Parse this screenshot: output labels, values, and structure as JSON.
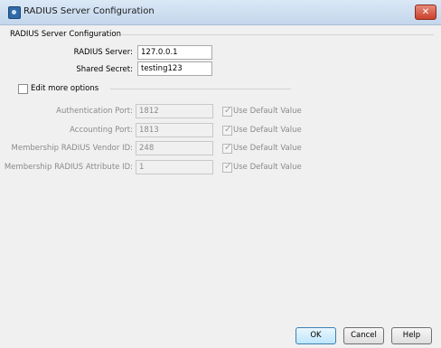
{
  "window": {
    "title": "RADIUS Server Configuration",
    "close_symbol": "✕"
  },
  "group": {
    "title": "RADIUS Server Configuration"
  },
  "server": {
    "label": "RADIUS Server:",
    "value": "127.0.0.1"
  },
  "secret": {
    "label": "Shared Secret:",
    "value": "testing123"
  },
  "edit_more": {
    "label": "Edit more options",
    "checked": false
  },
  "options": [
    {
      "label": "Authentication Port:",
      "value": "1812",
      "default_label": "Use Default Value"
    },
    {
      "label": "Accounting Port:",
      "value": "1813",
      "default_label": "Use Default Value"
    },
    {
      "label": "Membership RADIUS Vendor ID:",
      "value": "248",
      "default_label": "Use Default Value"
    },
    {
      "label": "Membership RADIUS Attribute ID:",
      "value": "1",
      "default_label": "Use Default Value"
    }
  ],
  "buttons": {
    "ok": "OK",
    "cancel": "Cancel",
    "help": "Help"
  }
}
